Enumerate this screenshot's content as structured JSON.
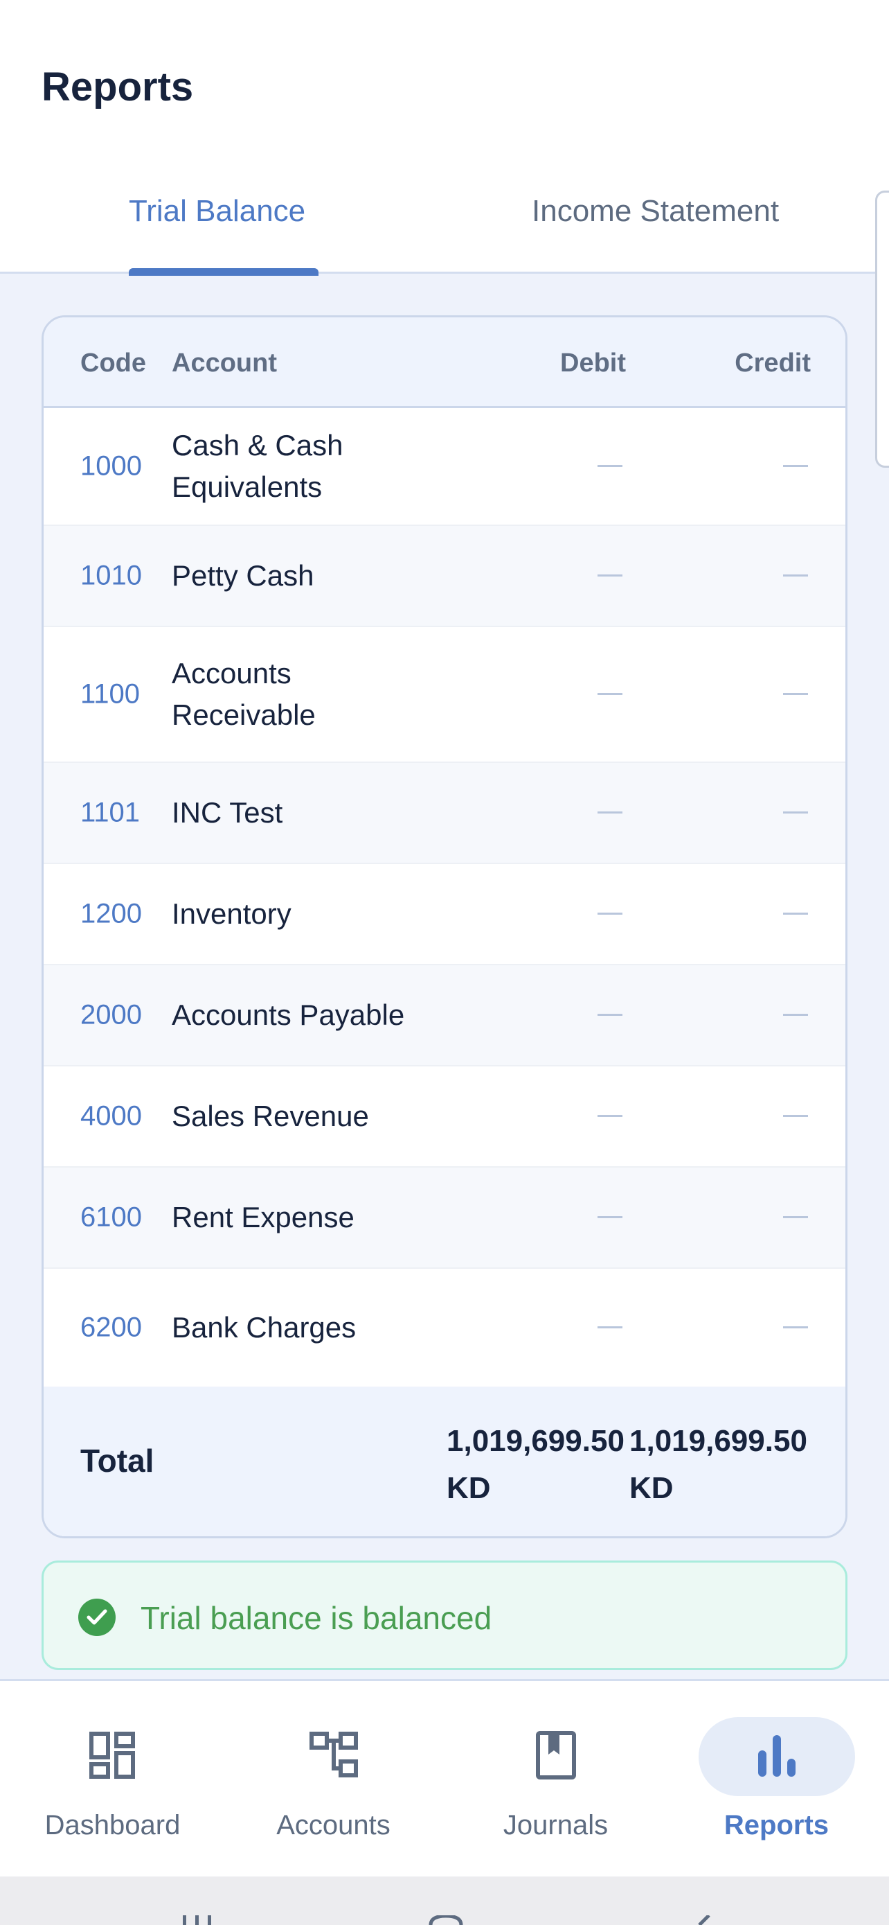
{
  "header": {
    "title": "Reports",
    "tabs": [
      {
        "label": "Trial Balance",
        "active": true
      },
      {
        "label": "Income Statement",
        "active": false
      }
    ]
  },
  "trial_balance": {
    "columns": {
      "code": "Code",
      "account": "Account",
      "debit": "Debit",
      "credit": "Credit"
    },
    "rows": [
      {
        "code": "1000",
        "account": "Cash & Cash Equivalents",
        "debit": "",
        "credit": ""
      },
      {
        "code": "1010",
        "account": "Petty Cash",
        "debit": "",
        "credit": ""
      },
      {
        "code": "1100",
        "account": "Accounts Receivable",
        "debit": "",
        "credit": ""
      },
      {
        "code": "1101",
        "account": "INC Test",
        "debit": "",
        "credit": ""
      },
      {
        "code": "1200",
        "account": "Inventory",
        "debit": "",
        "credit": ""
      },
      {
        "code": "2000",
        "account": "Accounts Payable",
        "debit": "",
        "credit": ""
      },
      {
        "code": "4000",
        "account": "Sales Revenue",
        "debit": "",
        "credit": ""
      },
      {
        "code": "6100",
        "account": "Rent Expense",
        "debit": "",
        "credit": ""
      },
      {
        "code": "6200",
        "account": "Bank Charges",
        "debit": "",
        "credit": ""
      }
    ],
    "total": {
      "label": "Total",
      "debit": "1,019,699.50 KD",
      "credit": "1,019,699.50 KD"
    }
  },
  "status": {
    "message": "Trial balance is balanced",
    "icon": "check-circle-icon",
    "color": "#3f9e4f"
  },
  "bottom_nav": [
    {
      "label": "Dashboard",
      "icon": "dashboard-icon",
      "active": false
    },
    {
      "label": "Accounts",
      "icon": "accounts-tree-icon",
      "active": false
    },
    {
      "label": "Journals",
      "icon": "journal-book-icon",
      "active": false
    },
    {
      "label": "Reports",
      "icon": "bar-chart-icon",
      "active": true
    }
  ],
  "colors": {
    "accent": "#4d79c5",
    "background": "#eef2fb",
    "success": "#3f9e4f"
  }
}
